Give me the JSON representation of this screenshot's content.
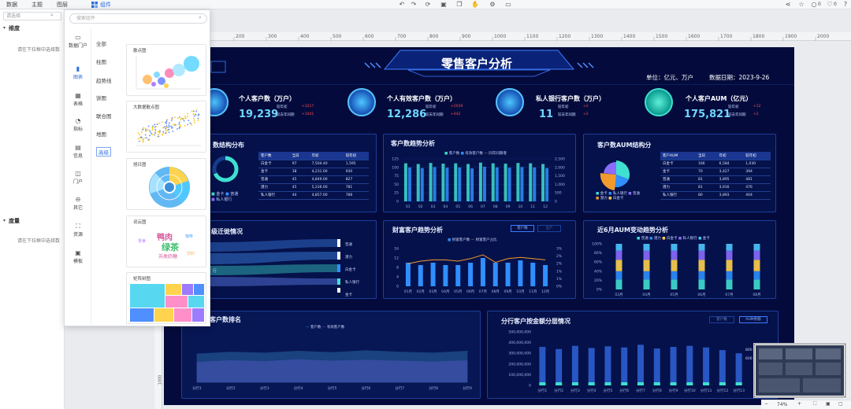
{
  "topbar": {
    "tabs": [
      "数据",
      "主题",
      "图层"
    ],
    "component_tab": "组件",
    "comments_count": "0",
    "likes_count": "0"
  },
  "left_panel": {
    "search_placeholder": "请选择",
    "dimension_label": "维度",
    "dimension_hint": "请在下拉框中选择数",
    "measure_label": "度量",
    "measure_hint": "请在下拉框中选择数"
  },
  "popup": {
    "search_placeholder": "搜索组件",
    "side": [
      {
        "label": "数据门户",
        "icon": "monitor-icon"
      },
      {
        "label": "图表",
        "icon": "bar-chart-icon"
      },
      {
        "label": "表格",
        "icon": "table-icon"
      },
      {
        "label": "指标",
        "icon": "gauge-icon"
      },
      {
        "label": "信息",
        "icon": "info-icon"
      },
      {
        "label": "门户",
        "icon": "portal-icon"
      },
      {
        "label": "其它",
        "icon": "more-icon"
      },
      {
        "label": "资源",
        "icon": "resource-icon"
      },
      {
        "label": "模板",
        "icon": "template-icon"
      }
    ],
    "active_side": "图表",
    "sub": [
      "全部",
      "柱图",
      "趋势线",
      "饼图",
      "联合图",
      "地图",
      "高级"
    ],
    "active_sub": "高级",
    "cards": [
      "散点图",
      "大数据散点图",
      "旭日图",
      "词云图",
      "矩阵树图"
    ],
    "wordcloud_words": [
      "鸭肉",
      "绿茶",
      "苏类奶糖",
      "零食",
      "咖啡",
      "饮料"
    ]
  },
  "ruler": {
    "ticks": [
      "200",
      "300",
      "400",
      "500",
      "600",
      "700",
      "800",
      "900",
      "1000",
      "1100",
      "1200",
      "1300",
      "1400",
      "1500",
      "1600",
      "1700",
      "1800",
      "1900",
      "2000"
    ],
    "v_tick": "1000"
  },
  "dashboard": {
    "title": "零售客户分析",
    "branch_tag": "行",
    "unit": "单位：亿元、万户",
    "date_label": "数据日期：2023-9-26",
    "kpis": [
      {
        "title": "个人客户数（万户）",
        "value": "19,239",
        "line1": "较年初",
        "line2": "较去年同期",
        "delta1": "+3217",
        "delta2": "+1041"
      },
      {
        "title": "个人有效客户数（万户）",
        "value": "12,286",
        "line1": "较年初",
        "line2": "较去年同期",
        "delta1": "+2039",
        "delta2": "+442"
      },
      {
        "title": "私人银行客户数（万户）",
        "value": "11",
        "line1": "较年初",
        "line2": "较去年同期",
        "delta1": "+2",
        "delta2": "+2"
      },
      {
        "title": "个人客户AUM（亿元）",
        "value": "175,821",
        "line1": "较年初",
        "line2": "较去年同期",
        "delta1": "+12",
        "delta2": "+2"
      }
    ],
    "panels": {
      "structure": "数结构分布",
      "trend": "客户数趋势分析",
      "aum_structure": "客户数AUM结构分",
      "level": "级迁徙情况",
      "wealth": "财富客户趋势分析",
      "aum6": "近6月AUM变动趋势分析",
      "ranking": "客户数排名",
      "branch_layer": "分行客户按金额分层情况"
    },
    "structure_table": {
      "headers": [
        "客户数",
        "当日",
        "年初",
        "较年初"
      ],
      "rows": [
        [
          "白金卡",
          "97",
          "7,504.40",
          "1,595"
        ],
        [
          "金卡",
          "38",
          "4,231.00",
          "930"
        ],
        [
          "普通",
          "45",
          "4,849.00",
          "827"
        ],
        [
          "潜力",
          "45",
          "5,236.00",
          "781"
        ],
        [
          "私人银行",
          "44",
          "4,857.00",
          "788"
        ]
      ],
      "legend": [
        "金卡",
        "普通",
        "私人银行"
      ]
    },
    "aum_table": {
      "headers": [
        "客户AUM",
        "当日",
        "年初",
        "较年初"
      ],
      "rows": [
        [
          "白金卡",
          "166",
          "6,584",
          "1,030"
        ],
        [
          "金卡",
          "70",
          "3,427",
          "394"
        ],
        [
          "普通",
          "81",
          "3,895",
          "481"
        ],
        [
          "潜力",
          "81",
          "3,916",
          "476"
        ],
        [
          "私人银行",
          "80",
          "3,893",
          "404"
        ]
      ],
      "legend": [
        "金卡",
        "私人银行",
        "普通",
        "潜力",
        "白金卡"
      ]
    },
    "trend_legend": [
      "客户数",
      "有效客户数",
      "同年同期增"
    ],
    "wealth_legend": [
      "财富客户数",
      "财富客户占比"
    ],
    "wealth_buttons": [
      "客户数",
      "全户"
    ],
    "aum6_legend": [
      "普通",
      "潜力",
      "白金卡",
      "私人银行",
      "金卡"
    ],
    "level_labels": [
      "普通",
      "潜力",
      "白金卡",
      "私人银行",
      "金卡"
    ],
    "level_left_label": "行",
    "ranking_legend": [
      "客户数",
      "有效客户数"
    ],
    "branch_buttons": [
      "客户数",
      "AUM余额"
    ],
    "branch_side_labels": [
      "800",
      "600"
    ],
    "colors": {
      "bg": "#040b3c",
      "accent": "#3fe0d0",
      "blue": "#2f6fe0",
      "red": "#ff4d4d"
    }
  },
  "chart_data": [
    {
      "type": "bar",
      "title": "客户数趋势分析",
      "categories": [
        "01",
        "02",
        "03",
        "04",
        "05",
        "06",
        "07",
        "08",
        "09",
        "10",
        "11",
        "12"
      ],
      "ylim": [
        0,
        125
      ],
      "y2lim": [
        0,
        2500
      ],
      "y_ticks": [
        "0",
        "25",
        "50",
        "75",
        "100",
        "125"
      ],
      "y2_ticks": [
        "0",
        "500",
        "1,000",
        "1,500",
        "2,000",
        "2,500"
      ],
      "series": [
        {
          "name": "客户数",
          "values": [
            112,
            110,
            113,
            111,
            112,
            110,
            114,
            112,
            111,
            113,
            112,
            110
          ]
        },
        {
          "name": "有效客户数",
          "values": [
            100,
            98,
            101,
            99,
            100,
            97,
            102,
            100,
            99,
            101,
            100,
            98
          ]
        }
      ]
    },
    {
      "type": "bar",
      "title": "财富客户趋势分析",
      "categories": [
        "01月",
        "02月",
        "03月",
        "04月",
        "05月",
        "06月",
        "07月",
        "08月",
        "09月",
        "10月",
        "11月",
        "12月"
      ],
      "ylim": [
        0,
        16
      ],
      "y_ticks": [
        "0",
        "4",
        "8",
        "12",
        "16"
      ],
      "y2_ticks": [
        "0%",
        "1%",
        "1%",
        "2%",
        "2%",
        "3%"
      ],
      "series": [
        {
          "name": "财富客户数",
          "values": [
            10,
            9,
            10,
            9,
            9,
            10,
            12,
            10,
            10,
            11,
            10,
            9
          ]
        },
        {
          "name": "财富客户占比",
          "values": [
            1.8,
            2.0,
            2.1,
            2.1,
            2.0,
            2.2,
            2.5,
            1.9,
            2.2,
            2.3,
            2.2,
            2.1
          ]
        }
      ]
    },
    {
      "type": "bar",
      "title": "近6月AUM变动趋势分析",
      "categories": [
        "03月",
        "04月",
        "05月",
        "06月",
        "07月",
        "08月"
      ],
      "ylim": [
        0,
        100
      ],
      "y_ticks": [
        "0%",
        "20%",
        "40%",
        "60%",
        "80%",
        "100%"
      ],
      "series": [
        {
          "name": "普通",
          "values": [
            22,
            22,
            22,
            22,
            22,
            22
          ]
        },
        {
          "name": "潜力",
          "values": [
            18,
            18,
            18,
            18,
            18,
            18
          ]
        },
        {
          "name": "白金卡",
          "values": [
            25,
            25,
            25,
            25,
            25,
            25
          ]
        },
        {
          "name": "私人银行",
          "values": [
            20,
            20,
            20,
            20,
            20,
            20
          ]
        },
        {
          "name": "金卡",
          "values": [
            15,
            15,
            15,
            15,
            15,
            15
          ]
        }
      ]
    },
    {
      "type": "area",
      "title": "客户数排名",
      "categories": [
        "分行1",
        "分行2",
        "分行3",
        "分行4",
        "分行5",
        "分行6",
        "分行7",
        "分行8",
        "分行9"
      ],
      "series": [
        {
          "name": "客户数",
          "values": [
            60,
            64,
            62,
            66,
            63,
            67,
            64,
            62,
            66
          ]
        },
        {
          "name": "有效客户数",
          "values": [
            42,
            46,
            44,
            48,
            45,
            47,
            45,
            43,
            46
          ]
        }
      ]
    },
    {
      "type": "bar",
      "title": "分行客户按金额分层情况",
      "categories": [
        "分行1",
        "分行2",
        "分行3",
        "分行4",
        "分行5",
        "分行6",
        "分行7",
        "分行8",
        "分行9",
        "分行10",
        "分行11",
        "分行12",
        "分行13"
      ],
      "ylim": [
        0,
        500000000
      ],
      "y_ticks": [
        "0",
        "100,000,000",
        "200,000,000",
        "300,000,000",
        "400,000,000",
        "500,000,000"
      ],
      "values": [
        360000000,
        340000000,
        370000000,
        350000000,
        365000000,
        355000000,
        380000000,
        345000000,
        360000000,
        370000000,
        355000000,
        330000000,
        300000000
      ]
    }
  ],
  "minimap": {
    "zoom": "74%"
  }
}
